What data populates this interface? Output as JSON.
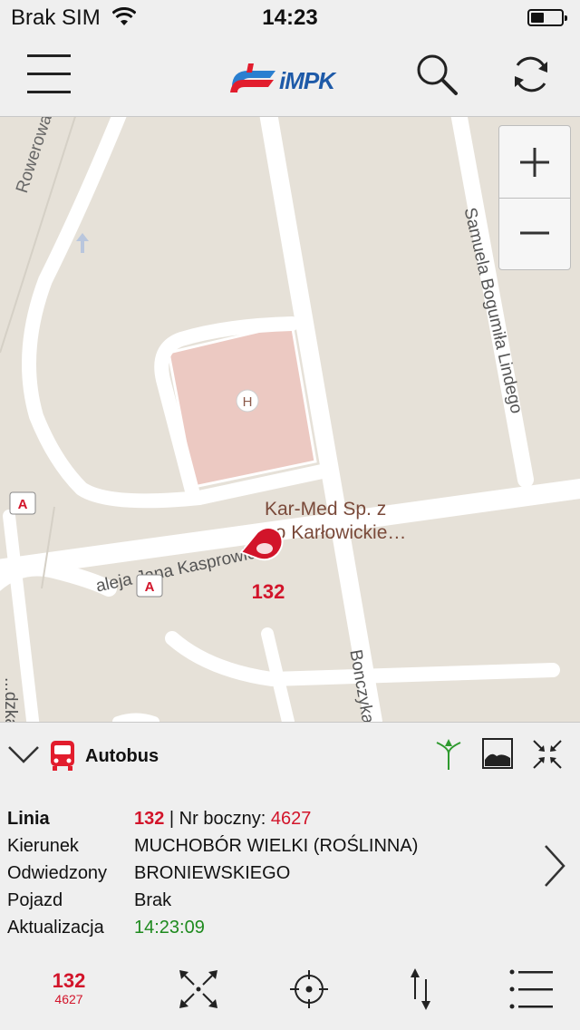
{
  "status_bar": {
    "carrier": "Brak SIM",
    "time": "14:23",
    "battery_level": 0.45
  },
  "nav": {
    "logo_text": "iMPK",
    "menu_icon": "hamburger-icon",
    "search_icon": "search-icon",
    "refresh_icon": "refresh-icon"
  },
  "map": {
    "streets": [
      "Rowerowa",
      "Samuela Bogumiła Lindego",
      "aleja Jana Kasprowicza",
      "Bonczyka",
      "...dzka"
    ],
    "poi": {
      "name_line1": "Kar-Med Sp. z",
      "name_line2": "oo Karłowickie…",
      "marker": "H"
    },
    "stop_marker": "A",
    "vehicle_number": "132",
    "zoom": {
      "plus": "+",
      "minus": "−"
    },
    "colors": {
      "background": "#e6e1d8",
      "road": "#ffffff",
      "poi_area": "#ecc9c2",
      "vehicle": "#d2142a"
    }
  },
  "panel": {
    "title": "Autobus",
    "icons": [
      "chevron-down-icon",
      "bus-icon",
      "route-fork-icon",
      "terrain-icon",
      "collapse-icon"
    ]
  },
  "info": {
    "line_label": "Linia",
    "line_value": "132",
    "side_label": " | Nr boczny: ",
    "side_value": "4627",
    "direction_label": "Kierunek",
    "direction_value": "MUCHOBÓR WIELKI (ROŚLINNA)",
    "visited_label": "Odwiedzony",
    "visited_value": "BRONIEWSKIEGO",
    "vehicle_label": "Pojazd",
    "vehicle_value": "Brak",
    "update_label": "Aktualizacja",
    "update_value": "14:23:09"
  },
  "tabbar": {
    "line_number": "132",
    "side_number": "4627",
    "icons": [
      "expand-icon",
      "locate-icon",
      "sort-icon",
      "list-icon"
    ]
  }
}
